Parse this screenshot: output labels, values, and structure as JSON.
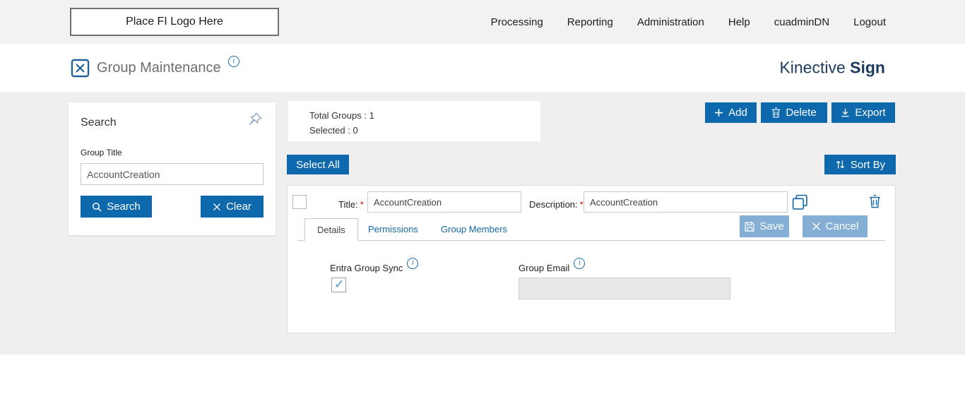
{
  "topbar": {
    "logo_text": "Place FI Logo Here",
    "nav": [
      {
        "label": "Processing"
      },
      {
        "label": "Reporting"
      },
      {
        "label": "Administration"
      },
      {
        "label": "Help"
      },
      {
        "label": "cuadminDN"
      },
      {
        "label": "Logout"
      }
    ]
  },
  "header": {
    "title": "Group Maintenance",
    "brand_regular": "Kinective ",
    "brand_bold": "Sign"
  },
  "search_panel": {
    "title": "Search",
    "group_title_label": "Group Title",
    "group_title_value": "AccountCreation",
    "search_button": "Search",
    "clear_button": "Clear"
  },
  "toolbar": {
    "total_groups_label": "Total Groups :",
    "total_groups_value": "1",
    "selected_label": "Selected :",
    "selected_value": "0",
    "add_label": "Add",
    "delete_label": "Delete",
    "export_label": "Export",
    "select_all_label": "Select All",
    "sort_by_label": "Sort By"
  },
  "group_row": {
    "title_label": "Title:",
    "required_mark": "*",
    "title_value": "AccountCreation",
    "description_label": "Description:",
    "description_value": "AccountCreation",
    "tabs": [
      {
        "label": "Details"
      },
      {
        "label": "Permissions"
      },
      {
        "label": "Group Members"
      }
    ],
    "save_label": "Save",
    "cancel_label": "Cancel",
    "entra_group_sync_label": "Entra Group Sync",
    "entra_group_sync_checked": true,
    "group_email_label": "Group Email",
    "group_email_value": ""
  },
  "icons": {
    "info": "i",
    "add": "+",
    "clear": "✕",
    "sort": "⇅",
    "export": "↓",
    "check": "✓"
  },
  "colors": {
    "primary_blue": "#0d68ac",
    "muted_blue": "#84aed4",
    "brand_navy": "#1e3c5f",
    "icon_blue": "#1a6aa6",
    "required_red": "#e00000",
    "topbar_bg": "#f2f2f2",
    "content_bg": "#efefef"
  }
}
